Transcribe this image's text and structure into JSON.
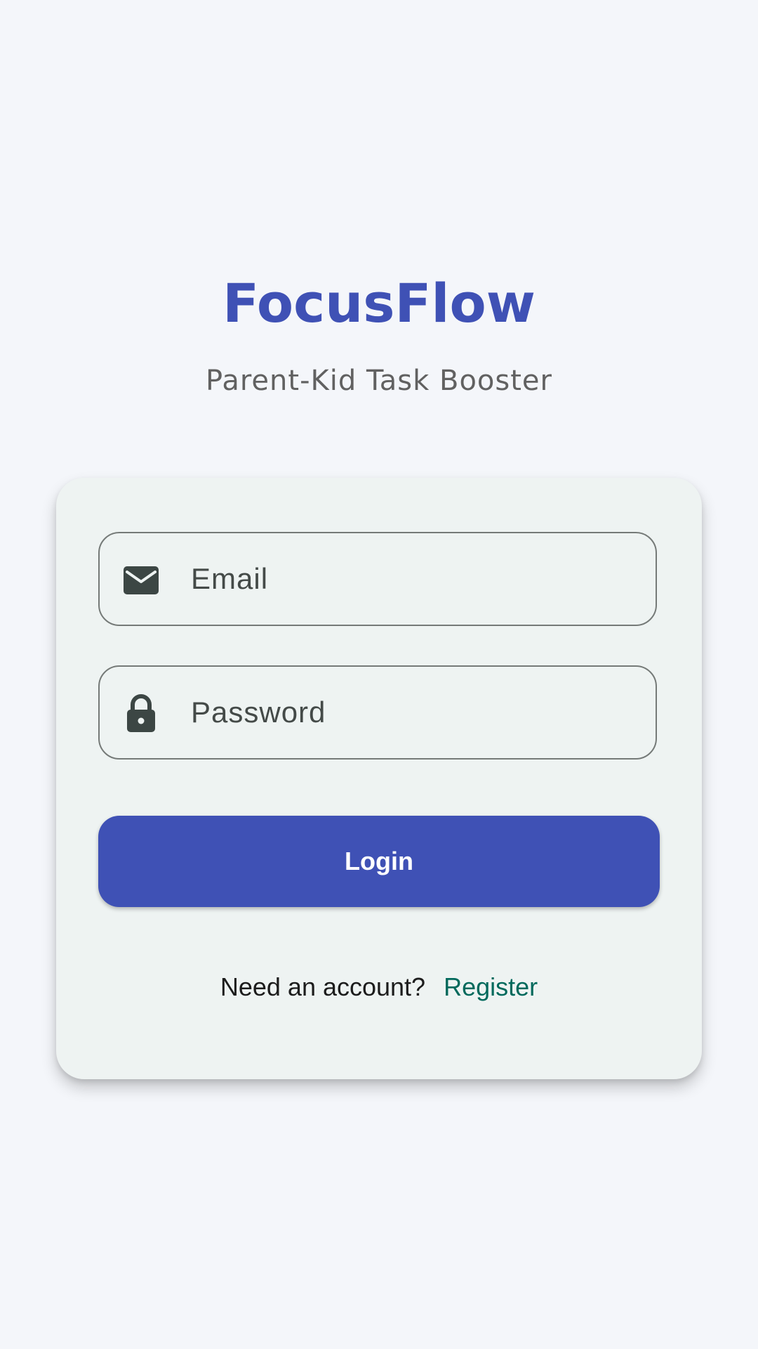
{
  "app": {
    "title": "FocusFlow",
    "subtitle": "Parent-Kid Task Booster"
  },
  "form": {
    "email_placeholder": "Email",
    "password_placeholder": "Password",
    "login_label": "Login",
    "register_prompt": "Need an account?",
    "register_label": "Register"
  },
  "icons": {
    "email": "envelope-icon",
    "password": "lock-icon"
  },
  "colors": {
    "primary": "#3f51b5",
    "link": "#00695c",
    "background": "#f4f6fa",
    "card": "#eef3f2"
  }
}
